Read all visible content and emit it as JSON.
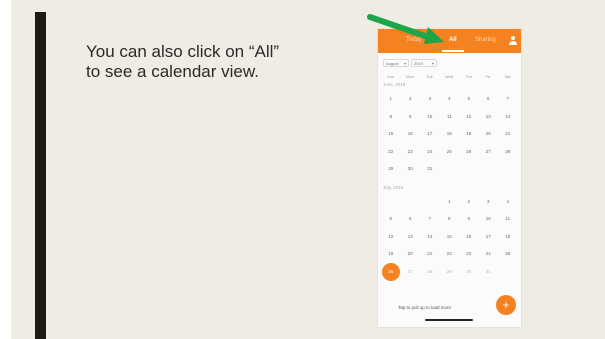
{
  "slide": {
    "caption": "You can also click on “All” to see a calendar view."
  },
  "phone": {
    "tabs": {
      "today": "Today",
      "all": "All",
      "sharing": "Sharing"
    },
    "selectors": {
      "month": "August",
      "year": "2019"
    },
    "days_of_week": [
      "Sun",
      "Mon",
      "Tue",
      "Wed",
      "Thu",
      "Fri",
      "Sat"
    ],
    "months": [
      {
        "label": "June, 2019",
        "weeks": [
          [
            "1",
            "2",
            "3",
            "4",
            "5",
            "6",
            "7"
          ],
          [
            "8",
            "9",
            "10",
            "11",
            "12",
            "13",
            "14"
          ],
          [
            "15",
            "16",
            "17",
            "18",
            "19",
            "20",
            "21"
          ],
          [
            "22",
            "23",
            "24",
            "25",
            "26",
            "27",
            "28"
          ],
          [
            "29",
            "30",
            "31",
            "",
            "",
            "",
            ""
          ]
        ]
      },
      {
        "label": "July, 2019",
        "weeks": [
          [
            "",
            "",
            "",
            "1",
            "2",
            "3",
            "4"
          ],
          [
            "5",
            "6",
            "7",
            "8",
            "9",
            "10",
            "11"
          ],
          [
            "12",
            "13",
            "14",
            "15",
            "16",
            "17",
            "18"
          ],
          [
            "19",
            "20",
            "21",
            "22",
            "23",
            "24",
            "25"
          ],
          [
            "26",
            "27",
            "28",
            "29",
            "30",
            "31",
            ""
          ]
        ]
      }
    ],
    "selected_day": "26",
    "pull_text": "Tap to pull up to load more",
    "fab_symbol": "+",
    "accent_color": "#f58220",
    "arrow_color": "#1ea54a"
  }
}
